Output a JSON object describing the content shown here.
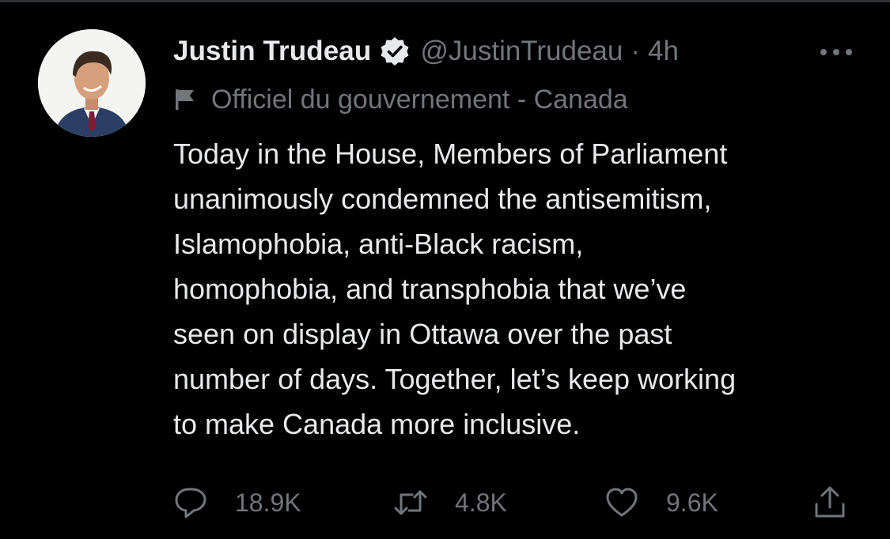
{
  "tweet": {
    "display_name": "Justin Trudeau",
    "handle": "@JustinTrudeau",
    "separator": "·",
    "time": "4h",
    "label": "Officiel du gouvernement - Canada",
    "text": "Today in the House, Members of Parliament\nunanimously condemned the antisemitism,\nIslamophobia, anti-Black racism,\nhomophobia, and transphobia that we’ve\nseen on display in Ottawa over the past\nnumber of days. Together, let’s keep working\nto make Canada more inclusive."
  },
  "actions": {
    "replies": "18.9K",
    "retweets": "4.8K",
    "likes": "9.6K"
  },
  "icons": {
    "verified": "verified-badge-icon",
    "more": "more-options-icon",
    "flag": "government-flag-icon",
    "reply": "reply-icon",
    "retweet": "retweet-icon",
    "like": "heart-icon",
    "share": "share-icon"
  },
  "colors": {
    "background": "#000000",
    "text": "#e7e9ea",
    "secondary": "#71767b",
    "verified_badge": "#e7e9ea"
  }
}
